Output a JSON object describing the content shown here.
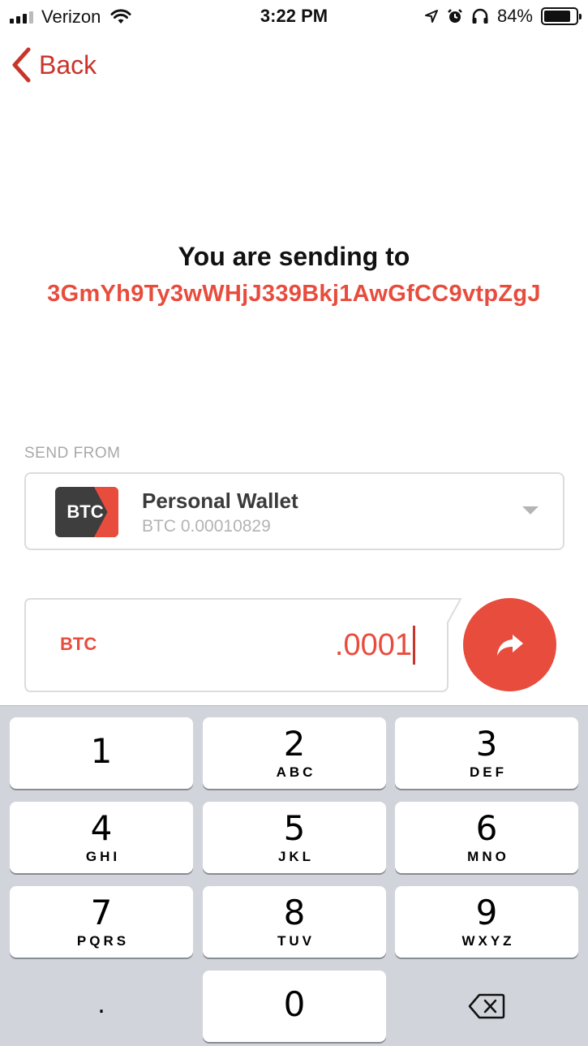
{
  "status_bar": {
    "carrier": "Verizon",
    "time": "3:22 PM",
    "battery_percent": "84%",
    "battery_level": 0.84,
    "icons": [
      "signal-icon",
      "wifi-icon",
      "location-icon",
      "alarm-icon",
      "headphones-icon",
      "battery-icon"
    ]
  },
  "nav": {
    "back_label": "Back"
  },
  "recipient": {
    "heading": "You are sending to",
    "address": "3GmYh9Ty3wWHjJ339Bkj1AwGfCC9vtpZgJ"
  },
  "send_from": {
    "label": "SEND FROM",
    "wallet_logo_text": "BTC",
    "wallet_name": "Personal Wallet",
    "wallet_balance": "BTC 0.00010829"
  },
  "amount": {
    "currency": "BTC",
    "value": ".0001"
  },
  "keypad": {
    "keys": [
      {
        "num": "1",
        "letters": ""
      },
      {
        "num": "2",
        "letters": "ABC"
      },
      {
        "num": "3",
        "letters": "DEF"
      },
      {
        "num": "4",
        "letters": "GHI"
      },
      {
        "num": "5",
        "letters": "JKL"
      },
      {
        "num": "6",
        "letters": "MNO"
      },
      {
        "num": "7",
        "letters": "PQRS"
      },
      {
        "num": "8",
        "letters": "TUV"
      },
      {
        "num": "9",
        "letters": "WXYZ"
      },
      {
        "num": ".",
        "letters": ""
      },
      {
        "num": "0",
        "letters": ""
      }
    ]
  },
  "colors": {
    "accent": "#e84c3d",
    "back": "#c9342b",
    "keyboard_bg": "#d1d4da"
  }
}
